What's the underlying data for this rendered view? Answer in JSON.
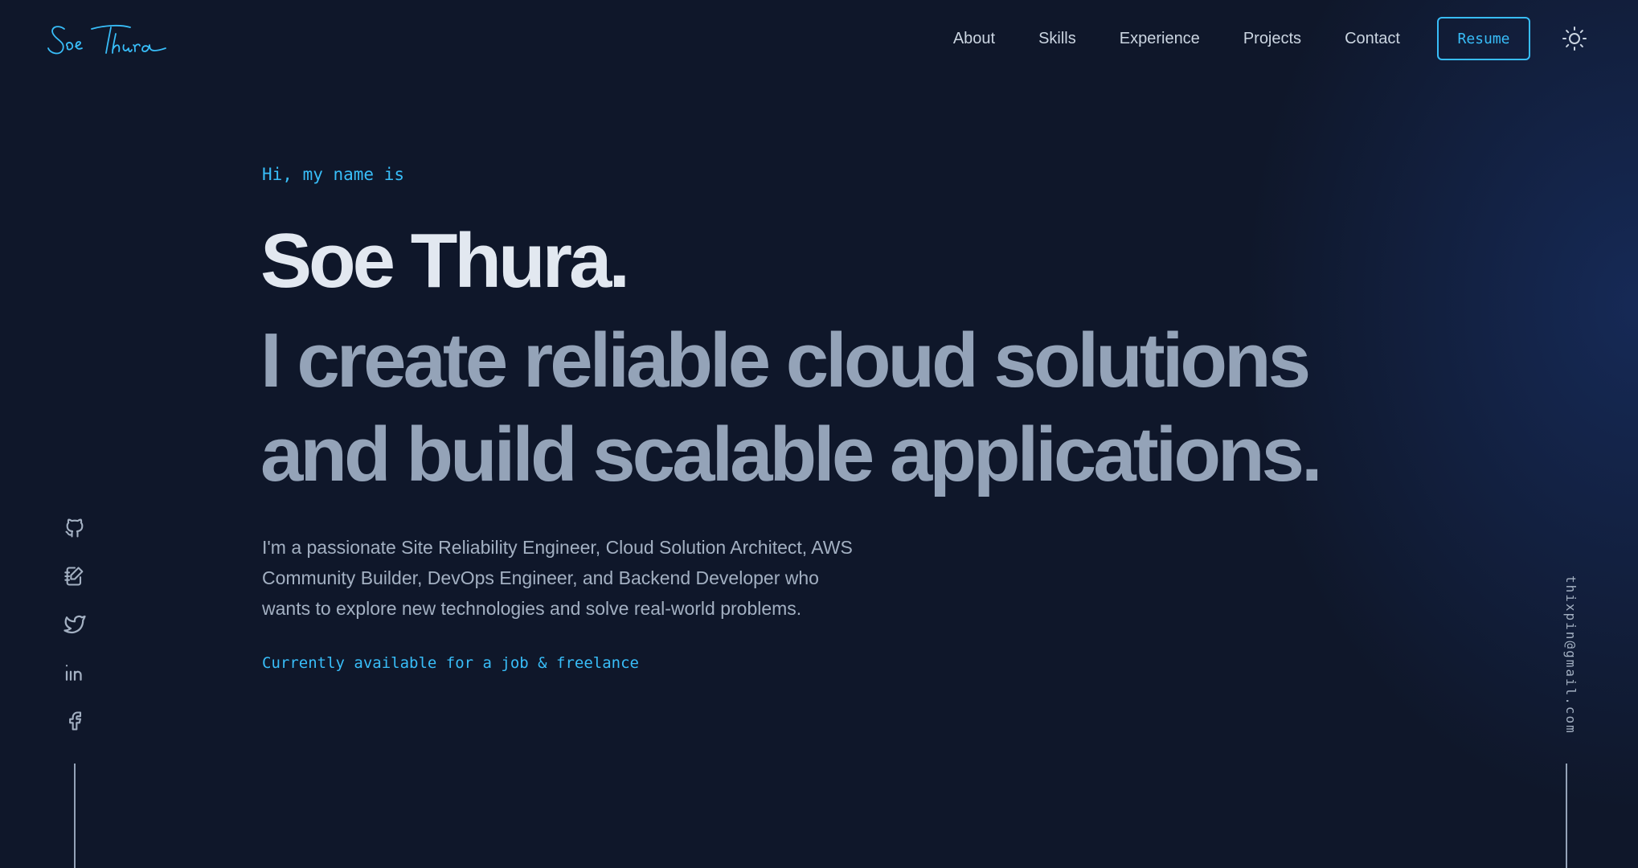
{
  "logo": {
    "text": "Soe Thura",
    "color": "#38bdf8"
  },
  "nav": {
    "items": [
      {
        "label": "About"
      },
      {
        "label": "Skills"
      },
      {
        "label": "Experience"
      },
      {
        "label": "Projects"
      },
      {
        "label": "Contact"
      }
    ],
    "resume_label": "Resume",
    "theme_toggle_icon": "sun-icon"
  },
  "hero": {
    "greeting": "Hi, my name is",
    "name": "Soe Thura.",
    "tagline_lines": [
      "I create reliable cloud solutions",
      "and build scalable applications."
    ],
    "intro_lines": [
      "I'm a passionate Site Reliability Engineer, Cloud Solution Architect, AWS",
      "Community Builder, DevOps Engineer, and Backend Developer who",
      "wants to explore new technologies and solve real-world problems."
    ],
    "availability": "Currently available for a job & freelance"
  },
  "social": {
    "icons": [
      "github-icon",
      "blog-notebook-icon",
      "twitter-icon",
      "linkedin-icon",
      "facebook-icon"
    ]
  },
  "email": "thixpin@gmail.com",
  "colors": {
    "background": "#0f172a",
    "accent": "#38bdf8",
    "heading": "#e2e8f0",
    "muted": "#94a3b8"
  }
}
